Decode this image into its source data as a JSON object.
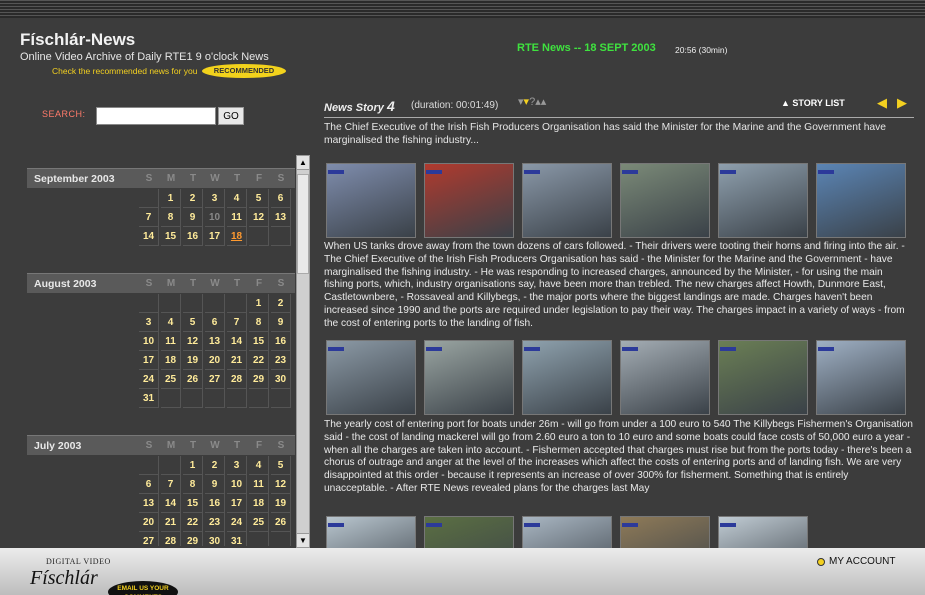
{
  "header": {
    "title": "Físchlár-News",
    "subtitle": "Online Video Archive of Daily RTE1 9 o'clock News",
    "recommend_text": "Check the recommended news for you",
    "recommend_badge": "RECOMMENDED",
    "broadcast": "RTE News -- 18 SEPT 2003",
    "broadcast_time": "20:56  (30min)"
  },
  "search": {
    "label": "SEARCH:",
    "value": "",
    "go_label": "GO"
  },
  "calendar": {
    "dow": [
      "S",
      "M",
      "T",
      "W",
      "T",
      "F",
      "S"
    ],
    "months": [
      {
        "name": "September  2003",
        "weeks": [
          [
            "",
            "1",
            "2",
            "3",
            "4",
            "5",
            "6"
          ],
          [
            "7",
            "8",
            "9",
            "10",
            "11",
            "12",
            "13"
          ],
          [
            "14",
            "15",
            "16",
            "17",
            "18",
            "",
            ""
          ]
        ]
      },
      {
        "name": "August  2003",
        "weeks": [
          [
            "",
            "",
            "",
            "",
            "",
            "1",
            "2"
          ],
          [
            "3",
            "4",
            "5",
            "6",
            "7",
            "8",
            "9"
          ],
          [
            "10",
            "11",
            "12",
            "13",
            "14",
            "15",
            "16"
          ],
          [
            "17",
            "18",
            "19",
            "20",
            "21",
            "22",
            "23"
          ],
          [
            "24",
            "25",
            "26",
            "27",
            "28",
            "29",
            "30"
          ],
          [
            "31",
            "",
            "",
            "",
            "",
            "",
            ""
          ]
        ]
      },
      {
        "name": "July  2003",
        "weeks": [
          [
            "",
            "",
            "1",
            "2",
            "3",
            "4",
            "5"
          ],
          [
            "6",
            "7",
            "8",
            "9",
            "10",
            "11",
            "12"
          ],
          [
            "13",
            "14",
            "15",
            "16",
            "17",
            "18",
            "19"
          ],
          [
            "20",
            "21",
            "22",
            "23",
            "24",
            "25",
            "26"
          ],
          [
            "27",
            "28",
            "29",
            "30",
            "31",
            "",
            ""
          ]
        ]
      }
    ]
  },
  "story": {
    "label": "News Story",
    "number": "4",
    "duration": "(duration: 00:01:49)",
    "story_list_label": "▲ STORY LIST",
    "intro": "The Chief Executive of the Irish Fish Producers Organisation has said the Minister for the Marine and the Government have marginalised the fishing industry...",
    "transcript_1": "When US tanks drove away from the town dozens of cars followed. - Their drivers were tooting their horns and firing into the air. - The Chief Executive of the Irish Fish Producers Organisation has said - the Minister for the Marine and the Government - have marginalised the fishing industry. - He was responding to increased charges, announced by the Minister, - for using the main fishing ports, which, industry organisations say, have been more than trebled. The new charges affect Howth, Dunmore East, Castletownbere, - Rossaveal and Killybegs, - the major ports where the biggest landings are made. Charges haven't been increased since 1990 and the ports are required under legislation to pay their way. The charges impact in a variety of ways - from the cost of entering ports to the landing of fish.",
    "transcript_2": "The yearly cost of entering port for boats under 26m - will go from under a 100 euro to 540 The Killybegs Fishermen's Organisation said - the cost of landing mackerel will go from 2.60 euro a ton to 10 euro and some boats could face costs of 50,000 euro a year - when all the charges are taken into account. - Fishermen accepted that charges must rise but from the ports today - there's been a chorus of outrage and anger at the level of the increases which affect the costs of entering ports and of landing fish. We are very disappointed at this order - because it represents an increase of over 300% for fisherment. Something that is entirely unacceptable. - After RTE News revealed plans for the charges last May"
  },
  "thumbnails": {
    "row1": [
      "#7f8dad",
      "#b03a2e",
      "#8a98a8",
      "#7b8a78",
      "#8fa0ae",
      "#5b85b5"
    ],
    "row2": [
      "#8c9aa6",
      "#9aa5a2",
      "#8fa2ae",
      "#a4adb4",
      "#6b7f55",
      "#9fb0c4"
    ],
    "row3": [
      "#b9c6cf",
      "#5b6f43",
      "#a9b6c2",
      "#8e7a58",
      "#c1ccd4"
    ]
  },
  "footer": {
    "logo_small": "DIGITAL VIDEO",
    "logo_main": "Físchlár",
    "email_badge": "EMAIL US YOUR COMMENTS",
    "account_label": "MY ACCOUNT"
  }
}
